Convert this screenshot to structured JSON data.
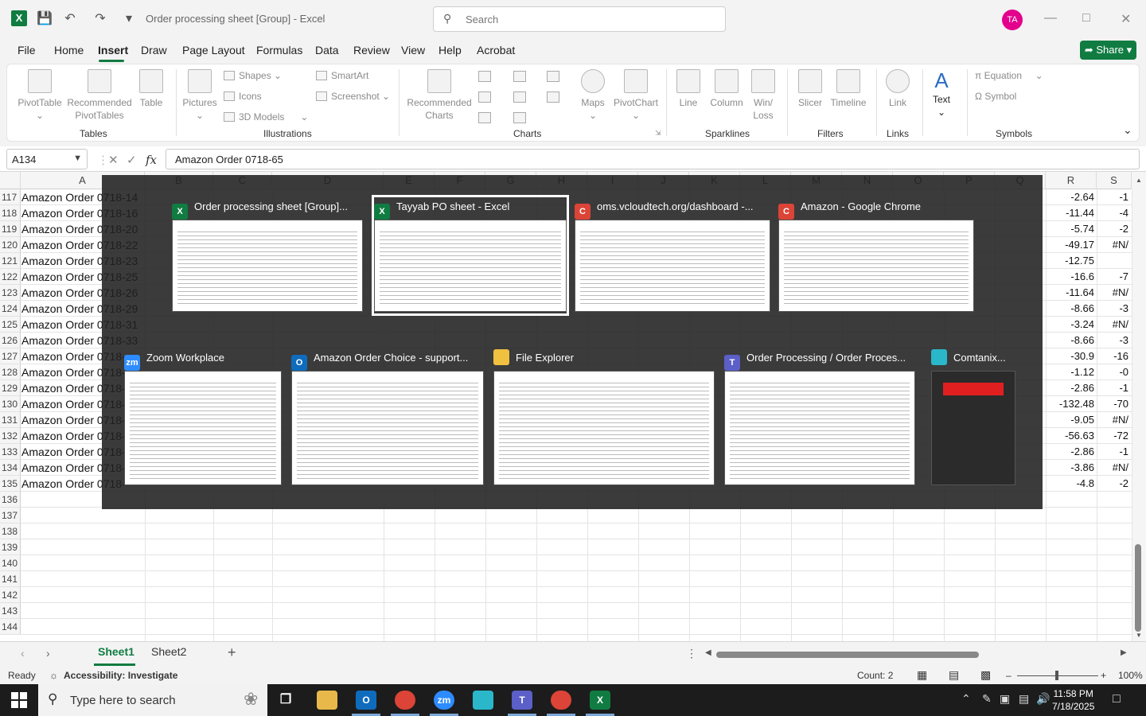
{
  "window": {
    "title": "Order processing sheet  [Group]  -  Excel",
    "search_placeholder": "Search",
    "avatar_initials": "TA",
    "share_label": "Share"
  },
  "menu": [
    "File",
    "Home",
    "Insert",
    "Draw",
    "Page Layout",
    "Formulas",
    "Data",
    "Review",
    "View",
    "Help",
    "Acrobat"
  ],
  "active_menu": "Insert",
  "ribbon": {
    "tables": {
      "label": "Tables",
      "pivottable": "PivotTable",
      "recommended_pivot_line1": "Recommended",
      "recommended_pivot_line2": "PivotTables",
      "table": "Table"
    },
    "illustrations": {
      "label": "Illustrations",
      "pictures": "Pictures",
      "shapes": "Shapes",
      "icons": "Icons",
      "models": "3D Models",
      "smartart": "SmartArt",
      "screenshot": "Screenshot"
    },
    "charts": {
      "label": "Charts",
      "recommended_line1": "Recommended",
      "recommended_line2": "Charts",
      "maps": "Maps",
      "pivotchart": "PivotChart"
    },
    "sparklines": {
      "label": "Sparklines",
      "line": "Line",
      "column": "Column",
      "winloss_line1": "Win/",
      "winloss_line2": "Loss"
    },
    "filters": {
      "label": "Filters",
      "slicer": "Slicer",
      "timeline": "Timeline"
    },
    "links": {
      "label": "Links",
      "link": "Link"
    },
    "text": {
      "text": "Text"
    },
    "symbols": {
      "label": "Symbols",
      "equation": "Equation",
      "symbol": "Symbol"
    }
  },
  "formula_bar": {
    "name_box": "A134",
    "formula": "Amazon Order 0718-65"
  },
  "columns": [
    "A",
    "B",
    "C",
    "D",
    "E",
    "F",
    "G",
    "H",
    "I",
    "J",
    "K",
    "L",
    "M",
    "N",
    "O",
    "P",
    "Q",
    "R",
    "S"
  ],
  "rows": [
    {
      "n": "117",
      "a": "Amazon Order 0718-14",
      "r": "-2.64",
      "s": "-1"
    },
    {
      "n": "118",
      "a": "Amazon Order 0718-16",
      "r": "-11.44",
      "s": "-4"
    },
    {
      "n": "119",
      "a": "Amazon Order 0718-20",
      "r": "-5.74",
      "s": "-2"
    },
    {
      "n": "120",
      "a": "Amazon Order 0718-22",
      "r": "-49.17",
      "s": "#N/"
    },
    {
      "n": "121",
      "a": "Amazon Order 0718-23",
      "r": "-12.75",
      "s": ""
    },
    {
      "n": "122",
      "a": "Amazon Order 0718-25",
      "r": "-16.6",
      "s": "-7"
    },
    {
      "n": "123",
      "a": "Amazon Order 0718-26",
      "r": "-11.64",
      "s": "#N/"
    },
    {
      "n": "124",
      "a": "Amazon Order 0718-29",
      "r": "-8.66",
      "s": "-3"
    },
    {
      "n": "125",
      "a": "Amazon Order 0718-31",
      "r": "-3.24",
      "s": "#N/"
    },
    {
      "n": "126",
      "a": "Amazon Order 0718-33",
      "r": "-8.66",
      "s": "-3"
    },
    {
      "n": "127",
      "a": "Amazon Order 0718-",
      "r": "-30.9",
      "s": "-16"
    },
    {
      "n": "128",
      "a": "Amazon Order 0718-",
      "r": "-1.12",
      "s": "-0"
    },
    {
      "n": "129",
      "a": "Amazon Order 0718-",
      "r": "-2.86",
      "s": "-1"
    },
    {
      "n": "130",
      "a": "Amazon Order 0718-",
      "r": "-132.48",
      "s": "-70"
    },
    {
      "n": "131",
      "a": "Amazon Order 0718-",
      "r": "-9.05",
      "s": "#N/"
    },
    {
      "n": "132",
      "a": "Amazon Order 0718-",
      "r": "-56.63",
      "s": "-72"
    },
    {
      "n": "133",
      "a": "Amazon Order 0718-",
      "r": "-2.86",
      "s": "-1"
    },
    {
      "n": "134",
      "a": "Amazon Order 0718-",
      "r": "-3.86",
      "s": "#N/"
    },
    {
      "n": "135",
      "a": "Amazon Order 0718-",
      "r": "-4.8",
      "s": "-2"
    },
    {
      "n": "136",
      "a": "",
      "r": "",
      "s": ""
    },
    {
      "n": "137",
      "a": "",
      "r": "",
      "s": ""
    },
    {
      "n": "138",
      "a": "",
      "r": "",
      "s": ""
    },
    {
      "n": "139",
      "a": "",
      "r": "",
      "s": ""
    },
    {
      "n": "140",
      "a": "",
      "r": "",
      "s": ""
    },
    {
      "n": "141",
      "a": "",
      "r": "",
      "s": ""
    },
    {
      "n": "142",
      "a": "",
      "r": "",
      "s": ""
    },
    {
      "n": "143",
      "a": "",
      "r": "",
      "s": ""
    },
    {
      "n": "144",
      "a": "",
      "r": "",
      "s": ""
    }
  ],
  "switcher": {
    "tiles": [
      {
        "title": "Order processing sheet  [Group]...",
        "icon": "X",
        "color": "#107c41"
      },
      {
        "title": "Tayyab PO sheet - Excel",
        "icon": "X",
        "color": "#107c41"
      },
      {
        "title": "oms.vcloudtech.org/dashboard -...",
        "icon": "C",
        "color": "#db4437"
      },
      {
        "title": "Amazon - Google Chrome",
        "icon": "C",
        "color": "#db4437"
      },
      {
        "title": "Zoom Workplace",
        "icon": "zm",
        "color": "#2d8cff"
      },
      {
        "title": "Amazon Order Choice - support...",
        "icon": "O",
        "color": "#0f6cbd"
      },
      {
        "title": "File Explorer",
        "icon": "",
        "color": "#f0c040"
      },
      {
        "title": "Order Processing / Order Proces...",
        "icon": "T",
        "color": "#5b5fc7"
      },
      {
        "title": "Comtanix...",
        "icon": "",
        "color": "#2ab7ca"
      }
    ]
  },
  "sheets": [
    "Sheet1",
    "Sheet2"
  ],
  "status": {
    "ready": "Ready",
    "accessibility": "Accessibility: Investigate",
    "count": "Count: 2",
    "zoom": "100%"
  },
  "taskbar": {
    "search_placeholder": "Type here to search",
    "time": "11:58 PM",
    "date": "7/18/2025"
  },
  "colors": {
    "excel_green": "#107c41",
    "accent_pink": "#e3008c",
    "taskbar": "#1c1c1c"
  }
}
